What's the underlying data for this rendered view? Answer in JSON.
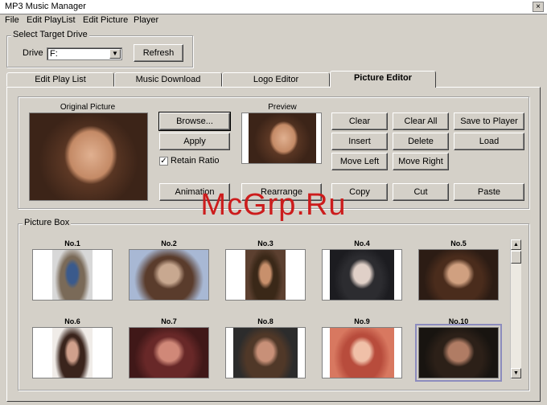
{
  "window": {
    "title": "MP3 Music Manager",
    "close_glyph": "×"
  },
  "menu": [
    "File",
    "Edit PlayList",
    "Edit Picture",
    "Player"
  ],
  "target_drive": {
    "group_label": "Select Target Drive",
    "drive_label": "Drive",
    "drive_value": "F:",
    "refresh_label": "Refresh"
  },
  "tabs": [
    {
      "label": "Edit Play List",
      "active": false
    },
    {
      "label": "Music Download",
      "active": false
    },
    {
      "label": "Logo Editor",
      "active": false
    },
    {
      "label": "Picture Editor",
      "active": true
    }
  ],
  "editor": {
    "original_caption": "Original Picture",
    "preview_caption": "Preview",
    "browse_label": "Browse...",
    "apply_label": "Apply",
    "retain_ratio_label": "Retain Ratio",
    "retain_ratio_checked": true,
    "animation_label": "Animation",
    "rearrange_label": "Rearrange",
    "actions_row1": [
      "Clear",
      "Clear All",
      "Save to Player"
    ],
    "actions_row2": [
      "Insert",
      "Delete",
      "Load"
    ],
    "actions_row3": [
      "Move Left",
      "Move Right"
    ],
    "actions_row4": [
      "Copy",
      "Cut",
      "Paste"
    ]
  },
  "picture_box": {
    "label": "Picture Box",
    "items": [
      {
        "label": "No.1",
        "colors": [
          "#d8d8d8",
          "#3a5a8c",
          "#7a6a58"
        ]
      },
      {
        "label": "No.2",
        "colors": [
          "#a8b8d4",
          "#c8a890",
          "#5a3c2c"
        ]
      },
      {
        "label": "No.3",
        "colors": [
          "#5c4030",
          "#c8906c",
          "#3a2818"
        ]
      },
      {
        "label": "No.4",
        "colors": [
          "#1c1c20",
          "#e0d0c8",
          "#2c2c30"
        ]
      },
      {
        "label": "No.5",
        "colors": [
          "#2c1c14",
          "#d0a080",
          "#4a2c1c"
        ]
      },
      {
        "label": "No.6",
        "colors": [
          "#f0ece8",
          "#d0a08c",
          "#3a241c"
        ]
      },
      {
        "label": "No.7",
        "colors": [
          "#401818",
          "#d08878",
          "#682828"
        ]
      },
      {
        "label": "No.8",
        "colors": [
          "#2c2c2c",
          "#c89078",
          "#503828"
        ]
      },
      {
        "label": "No.9",
        "colors": [
          "#d87860",
          "#f0c0a8",
          "#b84c3c"
        ]
      },
      {
        "label": "No.10",
        "colors": [
          "#181410",
          "#b07c64",
          "#2c2018"
        ]
      }
    ],
    "selected_index": 9
  },
  "watermark": "McGrp.Ru"
}
